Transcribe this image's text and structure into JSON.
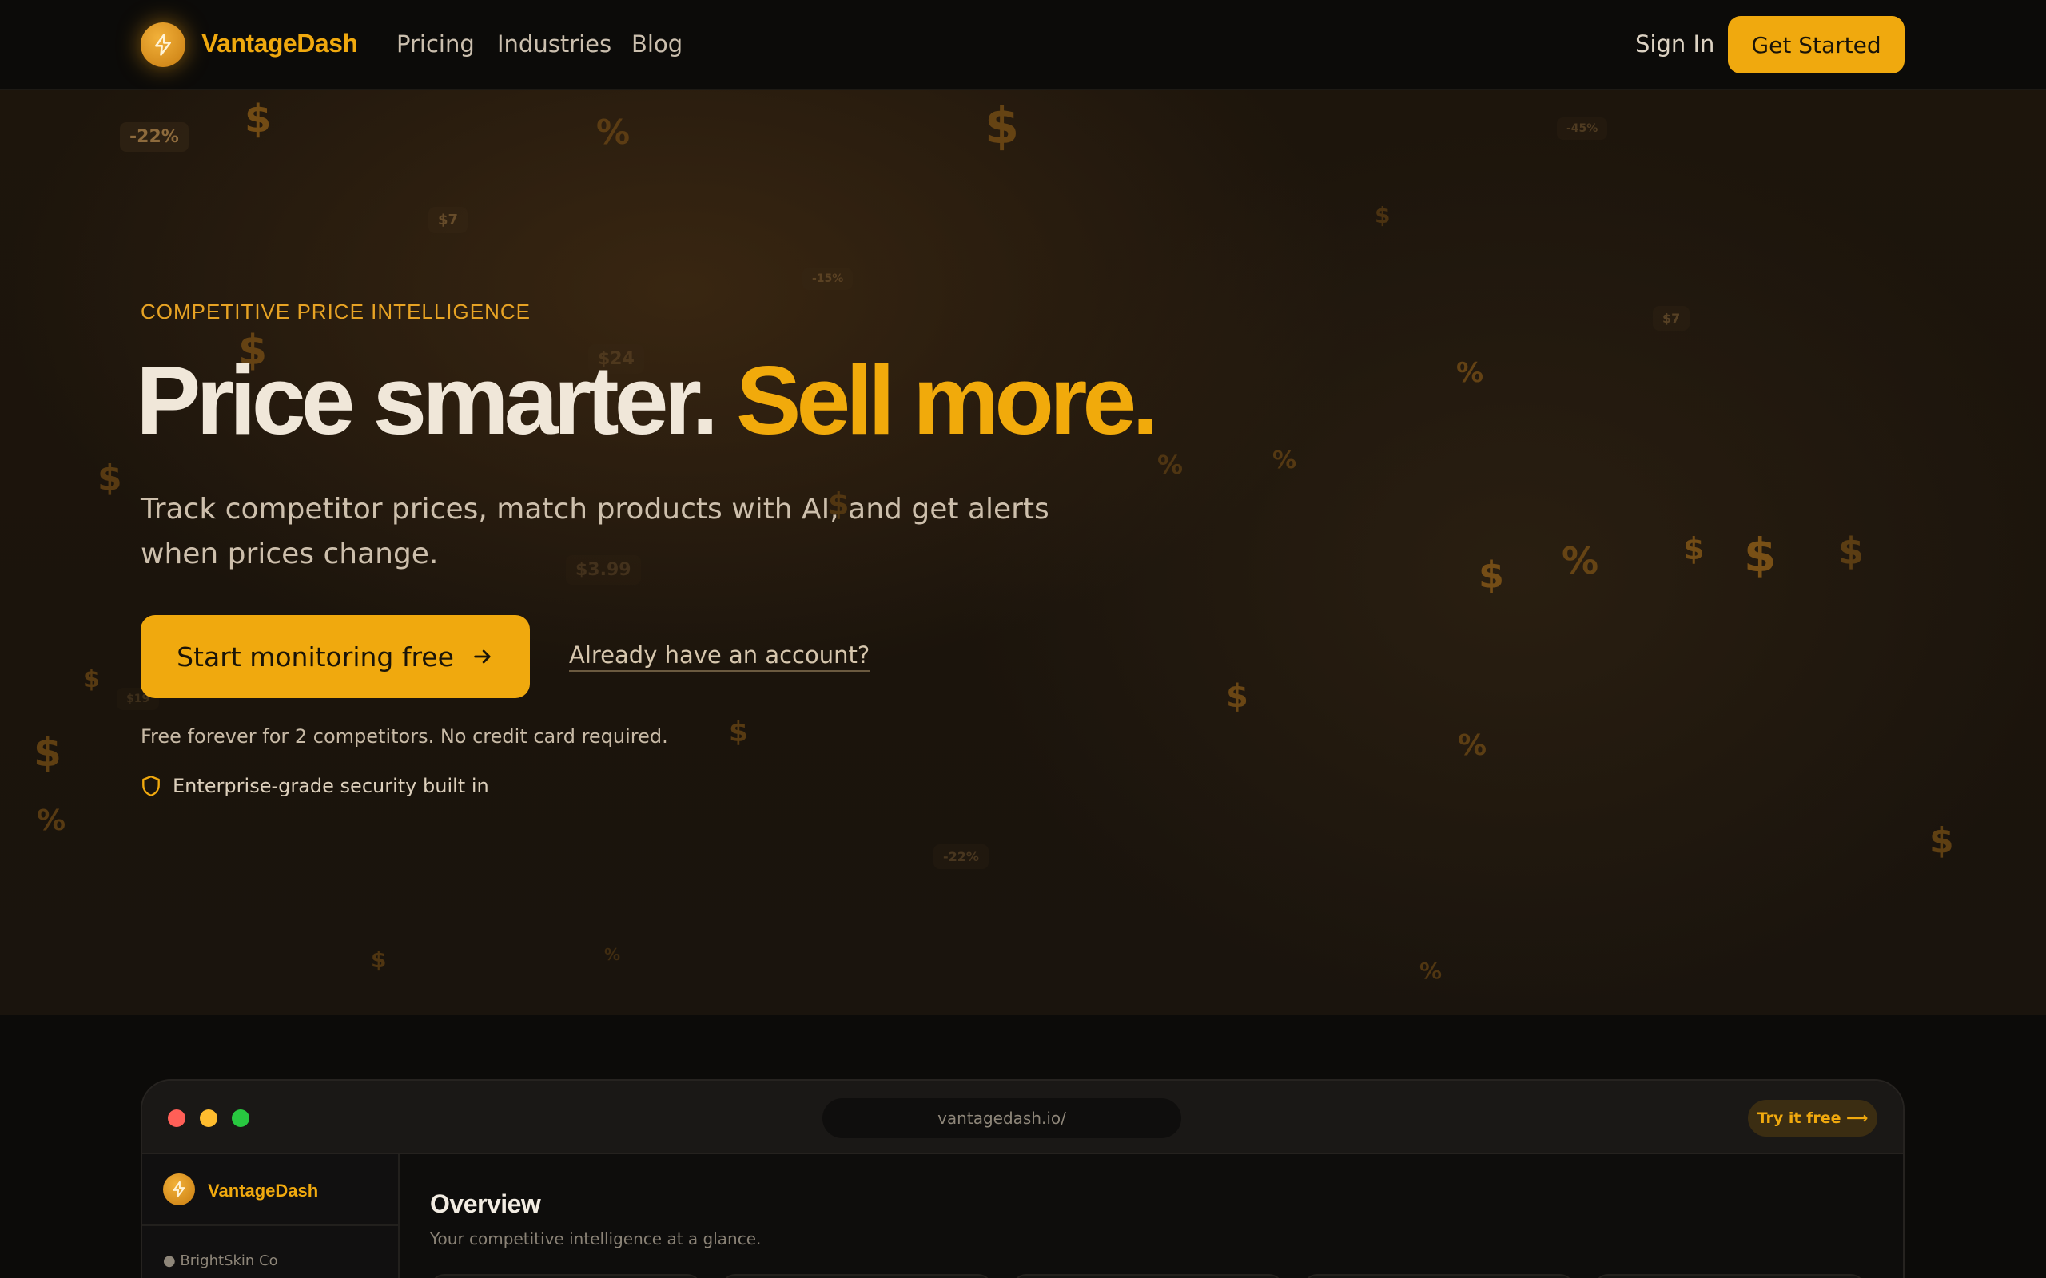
{
  "nav": {
    "brand": "VantageDash",
    "links": [
      "Pricing",
      "Industries",
      "Blog"
    ],
    "sign_in": "Sign In",
    "get_started": "Get Started"
  },
  "hero": {
    "eyebrow": "COMPETITIVE PRICE INTELLIGENCE",
    "headline_white": "Price smarter.",
    "headline_gold": "Sell more.",
    "subhead": "Track competitor prices, match products with AI, and get alerts when prices change.",
    "cta": "Start monitoring free",
    "secondary_link": "Already have an account?",
    "free_note": "Free forever for 2 competitors. No credit card required.",
    "security": "Enterprise-grade security built in",
    "decorations": {
      "badges": [
        "-22%",
        "$7",
        "-15%",
        "$24",
        "$7",
        "-45%",
        "$3.99",
        "$19",
        "-22%"
      ],
      "dollar": "$",
      "percent": "%"
    }
  },
  "preview": {
    "url": "vantagedash.io/",
    "try_free": "Try it free ⟶",
    "sidebar_brand": "VantageDash",
    "org": "● BrightSkin Co",
    "title": "Overview",
    "subtitle": "Your competitive intelligence at a glance."
  },
  "colors": {
    "accent": "#f0a90e",
    "background": "#0c0b09",
    "traffic_red": "#ff5f57",
    "traffic_yellow": "#febc2e",
    "traffic_green": "#28c840"
  }
}
